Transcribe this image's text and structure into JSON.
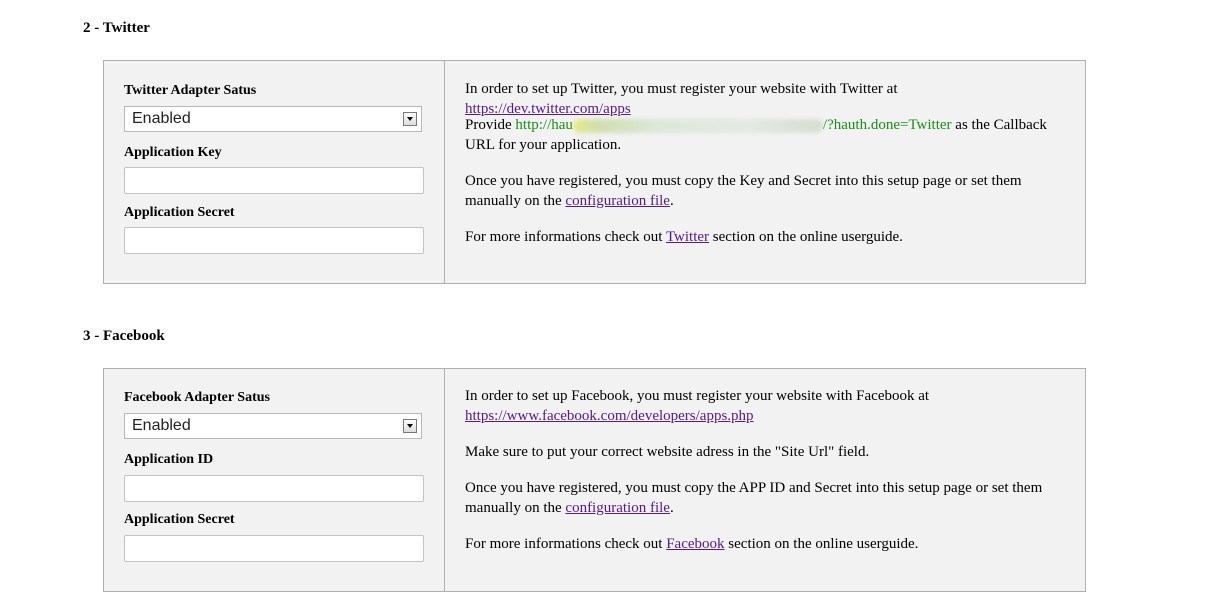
{
  "twitter": {
    "heading": "2 - Twitter",
    "status_label": "Twitter Adapter Satus",
    "status_value": "Enabled",
    "key_label": "Application Key",
    "secret_label": "Application Secret",
    "info": {
      "p1_text": "In order to set up Twitter, you must register your website with Twitter at ",
      "p1_link": "https://dev.twitter.com/apps",
      "p2_prefix": "Provide ",
      "p2_url_start": "http://hau",
      "p2_url_end": "/?hauth.done=Twitter",
      "p2_suffix": " as the Callback URL for your application.",
      "p3_text": "Once you have registered, you must copy the Key and Secret into this setup page or set them manually on the ",
      "p3_link": "configuration file",
      "p3_end": ".",
      "p4_text": "For more informations check out ",
      "p4_link": "Twitter",
      "p4_end": " section on the online userguide."
    }
  },
  "facebook": {
    "heading": "3 - Facebook",
    "status_label": "Facebook Adapter Satus",
    "status_value": "Enabled",
    "id_label": "Application ID",
    "secret_label": "Application Secret",
    "info": {
      "p1_text": "In order to set up Facebook, you must register your website with Facebook at ",
      "p1_link": "https://www.facebook.com/developers/apps.php",
      "p2_text": "Make sure to put your correct website adress in the \"Site Url\" field.",
      "p3_text": "Once you have registered, you must copy the APP ID and Secret into this setup page or set them manually on the ",
      "p3_link": "configuration file",
      "p3_end": ".",
      "p4_text": "For more informations check out ",
      "p4_link": "Facebook",
      "p4_end": " section on the online userguide."
    }
  }
}
